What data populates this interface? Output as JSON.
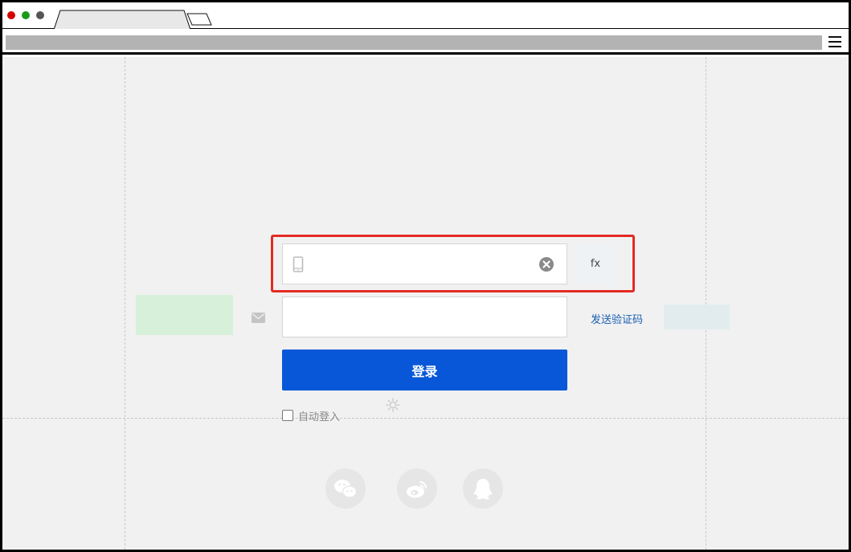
{
  "browser": {
    "tab_title": "",
    "url": ""
  },
  "login": {
    "phone_value": "",
    "phone_placeholder": "",
    "code_value": "",
    "code_placeholder": "",
    "fx_label": "fx",
    "send_code_label": "发送验证码",
    "login_label": "登录",
    "auto_login_label": "自动登入",
    "auto_login_checked": false
  },
  "social": [
    {
      "name": "wechat-icon"
    },
    {
      "name": "weibo-icon"
    },
    {
      "name": "qq-icon"
    }
  ],
  "colors": {
    "primary": "#0757d8",
    "highlight": "#e32b22",
    "link": "#1a5fb4",
    "background": "#f1f1f1"
  }
}
